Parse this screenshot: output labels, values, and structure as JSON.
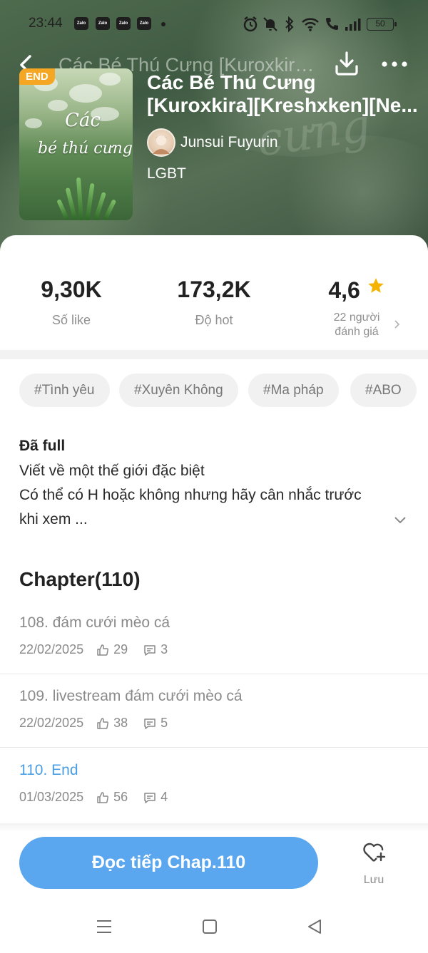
{
  "status_bar": {
    "time": "23:44",
    "notification_apps": [
      "Zalo",
      "Zalo",
      "Zalo",
      "Zalo"
    ],
    "battery": "50"
  },
  "header": {
    "title": "Các Bé Thú Cưng [Kuroxkira][Kreshxken][Ne...",
    "back_icon": "chevron-left-icon",
    "download_icon": "download-icon",
    "more_icon": "more-horizontal-icon"
  },
  "book": {
    "badge": "END",
    "cover_title_line1": "Các",
    "cover_title_line2": "bé thú cưng",
    "title_line1": "Các Bé Thú Cưng",
    "title_line2": "[Kuroxkira][Kreshxken][Ne...",
    "author": "Junsui Fuyurin",
    "genre": "LGBT"
  },
  "stats": {
    "likes": {
      "value": "9,30K",
      "label": "Số like"
    },
    "hot": {
      "value": "173,2K",
      "label": "Độ hot"
    },
    "rating": {
      "value": "4,6",
      "sub_line1": "22 người",
      "sub_line2": "đánh giá"
    }
  },
  "tags": [
    "#Tình yêu",
    "#Xuyên Không",
    "#Ma pháp",
    "#ABO"
  ],
  "description": {
    "title": "Đã full",
    "lines": [
      "Viết về một thế giới đặc biệt",
      "Có thể có H hoặc không nhưng hãy cân nhắc trước",
      "khi xem ..."
    ]
  },
  "chapters": {
    "heading": "Chapter(110)",
    "items": [
      {
        "title": "108. đám cưới mèo cá",
        "date": "22/02/2025",
        "likes": "29",
        "comments": "3",
        "current": false
      },
      {
        "title": "109. livestream đám cưới mèo cá",
        "date": "22/02/2025",
        "likes": "38",
        "comments": "5",
        "current": false
      },
      {
        "title": "110. End",
        "date": "01/03/2025",
        "likes": "56",
        "comments": "4",
        "current": true
      }
    ]
  },
  "actions": {
    "read_label": "Đọc tiếp Chap.110",
    "save_label": "Lưu"
  },
  "colors": {
    "accent": "#5aa7ef",
    "current_chapter": "#4a9de3",
    "badge": "#f5a623",
    "star": "#f5b301"
  }
}
